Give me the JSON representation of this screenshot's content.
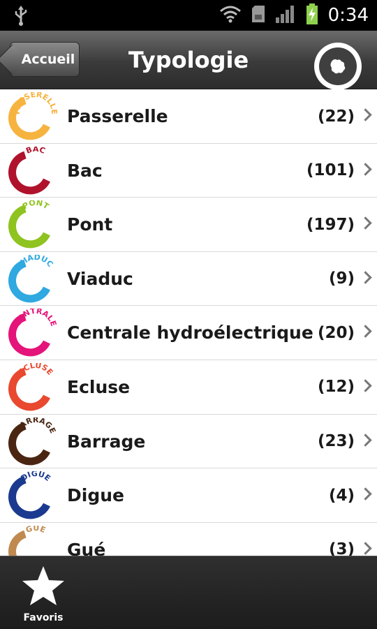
{
  "status_bar": {
    "time": "0:34"
  },
  "header": {
    "back_label": "Accueil",
    "title": "Typologie"
  },
  "items": [
    {
      "name": "Passerelle",
      "count": "(22)",
      "logo_text": "PASSERELLE",
      "color": "#F6B33F",
      "text_color": "#F6B33F"
    },
    {
      "name": "Bac",
      "count": "(101)",
      "logo_text": "BAC",
      "color": "#B0122C",
      "text_color": "#B0122C"
    },
    {
      "name": "Pont",
      "count": "(197)",
      "logo_text": "PONT",
      "color": "#8FC31F",
      "text_color": "#8FC31F"
    },
    {
      "name": "Viaduc",
      "count": "(9)",
      "logo_text": "VIADUC",
      "color": "#2FA9E0",
      "text_color": "#2FA9E0"
    },
    {
      "name": "Centrale hydroélectrique",
      "count": "(20)",
      "logo_text": "CENTRALE",
      "color": "#E4147A",
      "text_color": "#E4147A"
    },
    {
      "name": "Ecluse",
      "count": "(12)",
      "logo_text": "ECLUSE",
      "color": "#E8492F",
      "text_color": "#E8492F"
    },
    {
      "name": "Barrage",
      "count": "(23)",
      "logo_text": "BARRAGE",
      "color": "#4A2612",
      "text_color": "#4A2612"
    },
    {
      "name": "Digue",
      "count": "(4)",
      "logo_text": "DIGUE",
      "color": "#1B3A8F",
      "text_color": "#1B3A8F"
    },
    {
      "name": "Gué",
      "count": "(3)",
      "logo_text": "GUE",
      "color": "#C08A4F",
      "text_color": "#C08A4F"
    }
  ],
  "bottom_bar": {
    "favorites_label": "Favoris"
  },
  "icons": {
    "usb": "usb-icon",
    "wifi": "wifi-icon",
    "sd": "sd-card-icon",
    "signal": "signal-icon",
    "battery": "battery-charging-icon",
    "map": "map-icon",
    "star": "star-icon",
    "chevron": "chevron-right-icon"
  }
}
